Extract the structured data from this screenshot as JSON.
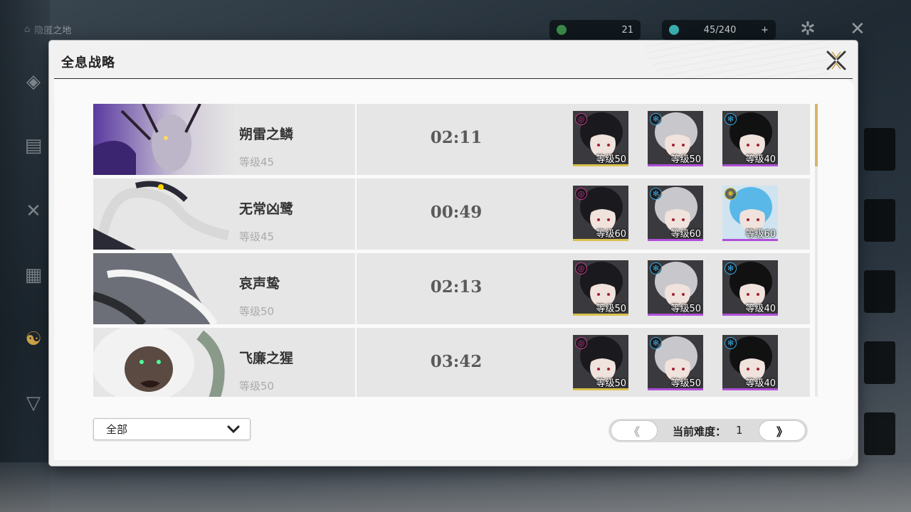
{
  "background": {
    "home_label": "隐匿之地",
    "resource_1": "21",
    "resource_2": "45/240",
    "resource_2_btn": "+"
  },
  "modal": {
    "title": "全息战略",
    "close_icon": "close-x-icon"
  },
  "rows": [
    {
      "name": "朔雷之鳞",
      "level": "等级45",
      "time": "02:11",
      "team": [
        {
          "element": "electro",
          "level": "等级50"
        },
        {
          "element": "glacio",
          "level": "等级50"
        },
        {
          "element": "glacio",
          "level": "等级40"
        }
      ]
    },
    {
      "name": "无常凶鹭",
      "level": "等级45",
      "time": "00:49",
      "team": [
        {
          "element": "electro",
          "level": "等级60"
        },
        {
          "element": "glacio",
          "level": "等级60"
        },
        {
          "element": "spectro",
          "level": "等级60"
        }
      ]
    },
    {
      "name": "哀声鸷",
      "level": "等级50",
      "time": "02:13",
      "team": [
        {
          "element": "electro",
          "level": "等级50"
        },
        {
          "element": "glacio",
          "level": "等级50"
        },
        {
          "element": "glacio",
          "level": "等级40"
        }
      ]
    },
    {
      "name": "飞廉之猩",
      "level": "等级50",
      "time": "03:42",
      "team": [
        {
          "element": "electro",
          "level": "等级50"
        },
        {
          "element": "glacio",
          "level": "等级50"
        },
        {
          "element": "glacio",
          "level": "等级40"
        }
      ]
    }
  ],
  "footer": {
    "filter_value": "全部",
    "prev_label": "《",
    "next_label": "》",
    "difficulty_label": "当前难度：",
    "difficulty_value": "1"
  },
  "colors": {
    "rarity_5": "#d9c14a",
    "rarity_4": "#b04fd8",
    "electro": "#c23a8c",
    "glacio": "#3aa7e0",
    "spectro": "#d6b422",
    "scroll_accent": "#d8b56a"
  }
}
